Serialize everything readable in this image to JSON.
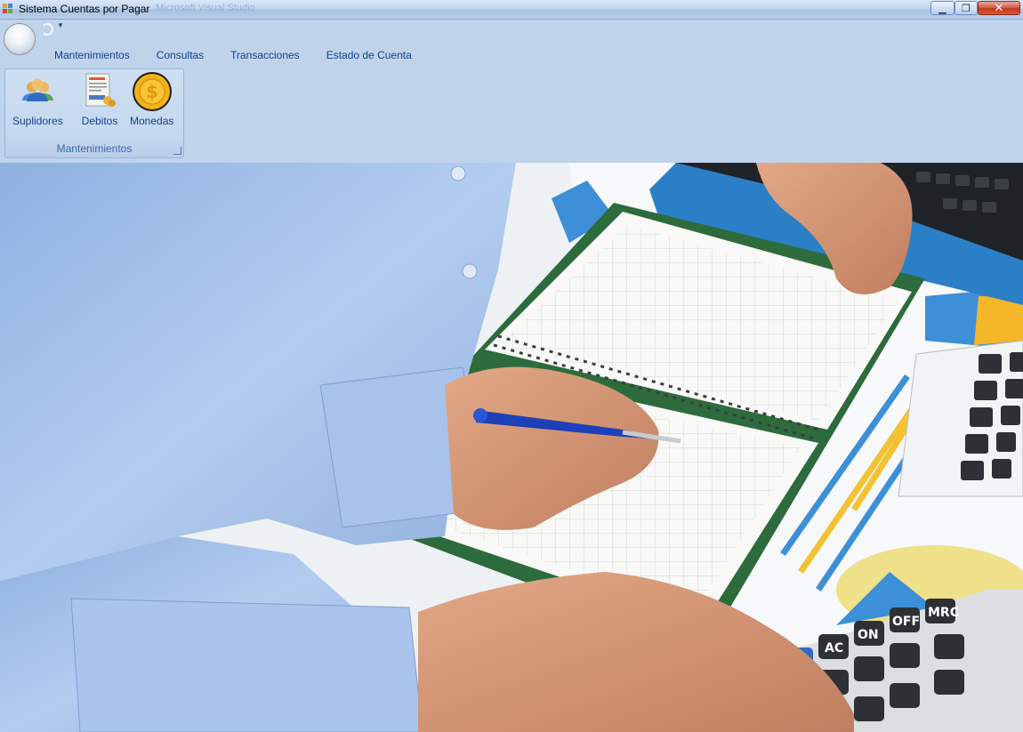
{
  "window": {
    "title": "Sistema Cuentas por Pagar",
    "faded_title": "Microsoft Visual Studio",
    "minimize_symbol": "▁",
    "maximize_symbol": "❐",
    "close_symbol": "✕"
  },
  "ribbon": {
    "tabs": [
      {
        "label": "Mantenimientos"
      },
      {
        "label": "Consultas"
      },
      {
        "label": "Transacciones"
      },
      {
        "label": "Estado de Cuenta"
      }
    ],
    "group": {
      "caption": "Mantenimientos",
      "buttons": [
        {
          "label": "Suplidores",
          "icon": "users-icon"
        },
        {
          "label": "Debitos",
          "icon": "invoice-icon"
        },
        {
          "label": "Monedas",
          "icon": "coin-icon"
        }
      ]
    }
  },
  "background_image": {
    "icon": "accounting-photo",
    "colors": {
      "shirt": "#a9c4ea",
      "paper": "#f6f7f8",
      "calculator": "#2e3338"
    }
  }
}
